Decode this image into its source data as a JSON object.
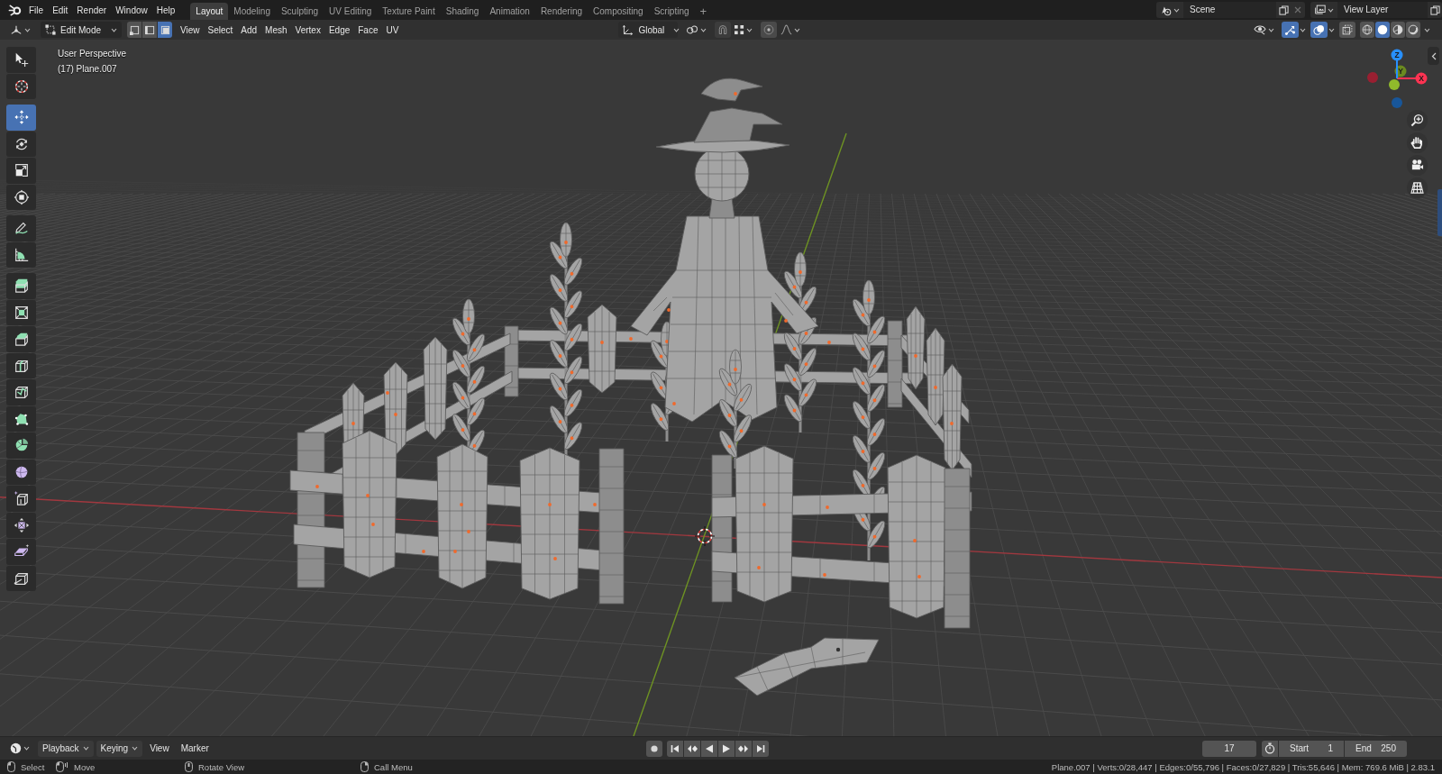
{
  "topbar": {
    "menus": [
      "File",
      "Edit",
      "Render",
      "Window",
      "Help"
    ],
    "workspaces": [
      {
        "label": "Layout",
        "selected": true
      },
      {
        "label": "Modeling",
        "selected": false
      },
      {
        "label": "Sculpting",
        "selected": false
      },
      {
        "label": "UV Editing",
        "selected": false
      },
      {
        "label": "Texture Paint",
        "selected": false
      },
      {
        "label": "Shading",
        "selected": false
      },
      {
        "label": "Animation",
        "selected": false
      },
      {
        "label": "Rendering",
        "selected": false
      },
      {
        "label": "Compositing",
        "selected": false
      },
      {
        "label": "Scripting",
        "selected": false
      }
    ],
    "add_workspace": "+",
    "scene": "Scene",
    "view_layer": "View Layer"
  },
  "viewport_header": {
    "mode": "Edit Mode",
    "select_modes": [
      {
        "kind": "vertex",
        "selected": false
      },
      {
        "kind": "edge",
        "selected": false
      },
      {
        "kind": "face",
        "selected": true
      }
    ],
    "menus": [
      "View",
      "Select",
      "Add",
      "Mesh",
      "Vertex",
      "Edge",
      "Face",
      "UV"
    ],
    "orientation": "Global",
    "toggles": [
      {
        "kind": "gizmos",
        "on": true
      },
      {
        "kind": "overlays",
        "on": true
      },
      {
        "kind": "xray",
        "on": false
      }
    ],
    "shading_modes": [
      {
        "kind": "wireframe",
        "selected": false
      },
      {
        "kind": "solid",
        "selected": true
      },
      {
        "kind": "material",
        "selected": false
      },
      {
        "kind": "rendered",
        "selected": false
      }
    ]
  },
  "viewport": {
    "view_name": "User Perspective",
    "object_info": "(17) Plane.007",
    "tool_groups": [
      [
        {
          "kind": "select_box",
          "selected": false
        },
        {
          "kind": "cursor",
          "selected": false
        }
      ],
      [
        {
          "kind": "move",
          "selected": true
        },
        {
          "kind": "rotate",
          "selected": false
        },
        {
          "kind": "scale",
          "selected": false
        },
        {
          "kind": "transform",
          "selected": false
        }
      ],
      [
        {
          "kind": "annotate",
          "selected": false
        },
        {
          "kind": "measure",
          "selected": false
        }
      ],
      [
        {
          "kind": "extrude",
          "selected": false
        },
        {
          "kind": "inset",
          "selected": false
        },
        {
          "kind": "bevel",
          "selected": false
        },
        {
          "kind": "loop_cut",
          "selected": false
        },
        {
          "kind": "knife",
          "selected": false
        },
        {
          "kind": "poly_build",
          "selected": false
        },
        {
          "kind": "spin",
          "selected": false
        },
        {
          "kind": "smooth",
          "selected": false
        },
        {
          "kind": "edge_slide",
          "selected": false
        },
        {
          "kind": "shrink_fatten",
          "selected": false
        },
        {
          "kind": "shear",
          "selected": false
        },
        {
          "kind": "rip",
          "selected": false
        }
      ]
    ],
    "gizmo_axes": [
      {
        "label": "X",
        "color": "#ff3352"
      },
      {
        "label": "Y",
        "color": "#6b8a20"
      },
      {
        "label": "Z",
        "color": "#2890ff"
      }
    ],
    "nav_buttons": [
      {
        "kind": "zoom"
      },
      {
        "kind": "pan"
      },
      {
        "kind": "camera"
      },
      {
        "kind": "ortho"
      }
    ]
  },
  "timeline": {
    "menus": [
      {
        "label": "Playback",
        "dropdown": true
      },
      {
        "label": "Keying",
        "dropdown": true
      },
      {
        "label": "View",
        "dropdown": false
      },
      {
        "label": "Marker",
        "dropdown": false
      }
    ],
    "current_frame": "17",
    "start": {
      "label": "Start",
      "value": "1"
    },
    "end": {
      "label": "End",
      "value": "250"
    }
  },
  "status_bar": {
    "hints": [
      {
        "kind": "left",
        "label": "Select"
      },
      {
        "kind": "drag",
        "label": "Move"
      },
      {
        "kind": "middle",
        "label": "Rotate View"
      },
      {
        "kind": "right",
        "label": "Call Menu"
      }
    ],
    "stats": "Plane.007 | Verts:0/28,447 | Edges:0/55,796 | Faces:0/27,829 | Tris:55,646 | Mem: 769.6 MiB | 2.83.1"
  }
}
